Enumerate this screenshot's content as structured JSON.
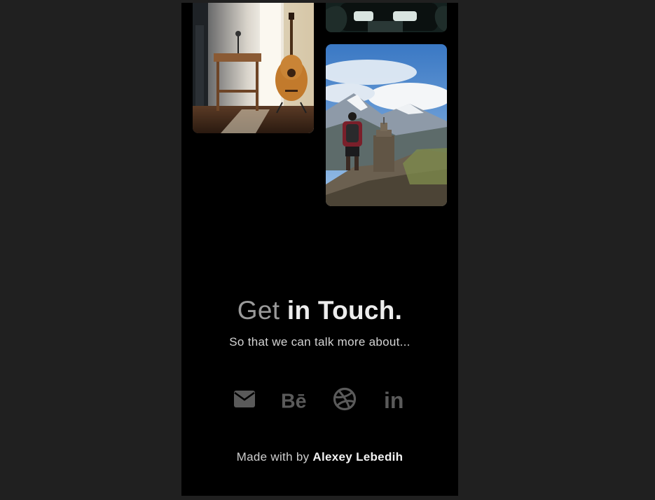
{
  "contact": {
    "heading_light": "Get ",
    "heading_bold": "in Touch.",
    "subtitle": "So that we can talk more about..."
  },
  "social_links": [
    {
      "name": "mail",
      "icon": "mail-icon"
    },
    {
      "name": "behance",
      "icon": "behance-icon",
      "glyph": "Bē"
    },
    {
      "name": "dribbble",
      "icon": "dribbble-icon"
    },
    {
      "name": "linkedin",
      "icon": "linkedin-icon",
      "glyph": "in"
    }
  ],
  "footer": {
    "made_with": "Made with by ",
    "author": "Alexey Lebedih"
  },
  "colors": {
    "page_bg": "#202020",
    "screen_bg": "#000000",
    "icon": "#5a5a5a",
    "heading_light": "#9a9a9a",
    "heading_bold": "#ededed"
  }
}
